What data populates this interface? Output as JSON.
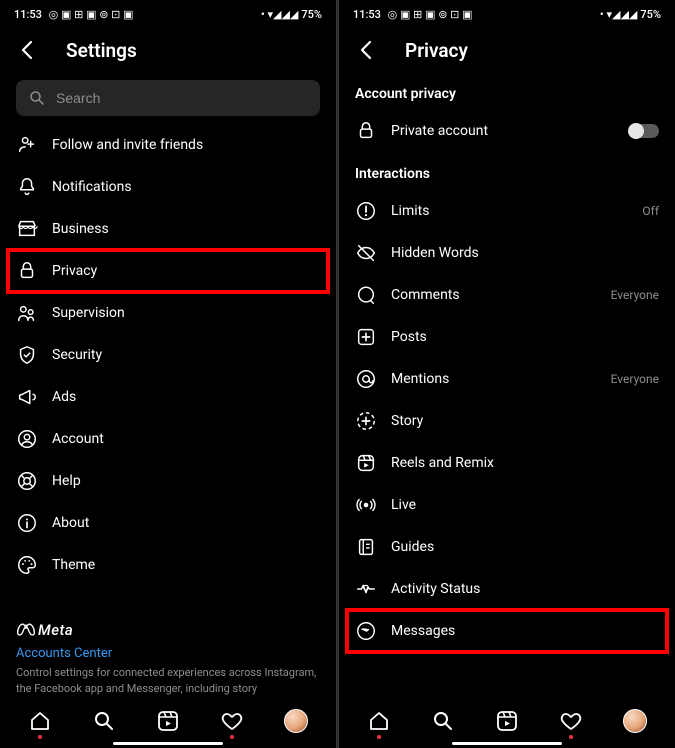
{
  "status": {
    "time": "11:53",
    "battery": "75%"
  },
  "left": {
    "title": "Settings",
    "search_placeholder": "Search",
    "items": [
      {
        "icon": "user-plus",
        "label": "Follow and invite friends"
      },
      {
        "icon": "bell",
        "label": "Notifications"
      },
      {
        "icon": "store",
        "label": "Business"
      },
      {
        "icon": "lock",
        "label": "Privacy",
        "highlight": true
      },
      {
        "icon": "supervision",
        "label": "Supervision"
      },
      {
        "icon": "shield",
        "label": "Security"
      },
      {
        "icon": "megaphone",
        "label": "Ads"
      },
      {
        "icon": "account",
        "label": "Account"
      },
      {
        "icon": "help",
        "label": "Help"
      },
      {
        "icon": "info",
        "label": "About"
      },
      {
        "icon": "palette",
        "label": "Theme"
      }
    ],
    "meta": {
      "brand": "Meta",
      "link": "Accounts Center",
      "desc": "Control settings for connected experiences across Instagram, the Facebook app and Messenger, including story"
    }
  },
  "right": {
    "title": "Privacy",
    "section1": "Account privacy",
    "private_account_label": "Private account",
    "section2": "Interactions",
    "items": [
      {
        "icon": "limits",
        "label": "Limits",
        "trail": "Off"
      },
      {
        "icon": "hidden",
        "label": "Hidden Words"
      },
      {
        "icon": "comments",
        "label": "Comments",
        "trail": "Everyone"
      },
      {
        "icon": "posts",
        "label": "Posts"
      },
      {
        "icon": "mentions",
        "label": "Mentions",
        "trail": "Everyone"
      },
      {
        "icon": "story",
        "label": "Story"
      },
      {
        "icon": "reels",
        "label": "Reels and Remix"
      },
      {
        "icon": "live",
        "label": "Live"
      },
      {
        "icon": "guides",
        "label": "Guides"
      },
      {
        "icon": "activity",
        "label": "Activity Status"
      },
      {
        "icon": "messages",
        "label": "Messages",
        "highlight": true
      }
    ]
  }
}
